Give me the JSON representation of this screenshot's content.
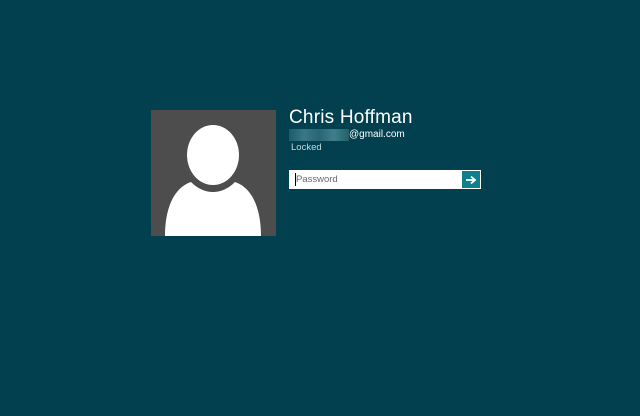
{
  "user": {
    "name": "Chris Hoffman",
    "email_domain": "@gmail.com",
    "status": "Locked"
  },
  "password": {
    "placeholder": "Password",
    "value": ""
  },
  "submit": {
    "icon": "arrow-right-icon"
  },
  "colors": {
    "background": "#03404f",
    "avatar_bg": "#4d4d4d",
    "accent": "#0e7f8c"
  }
}
